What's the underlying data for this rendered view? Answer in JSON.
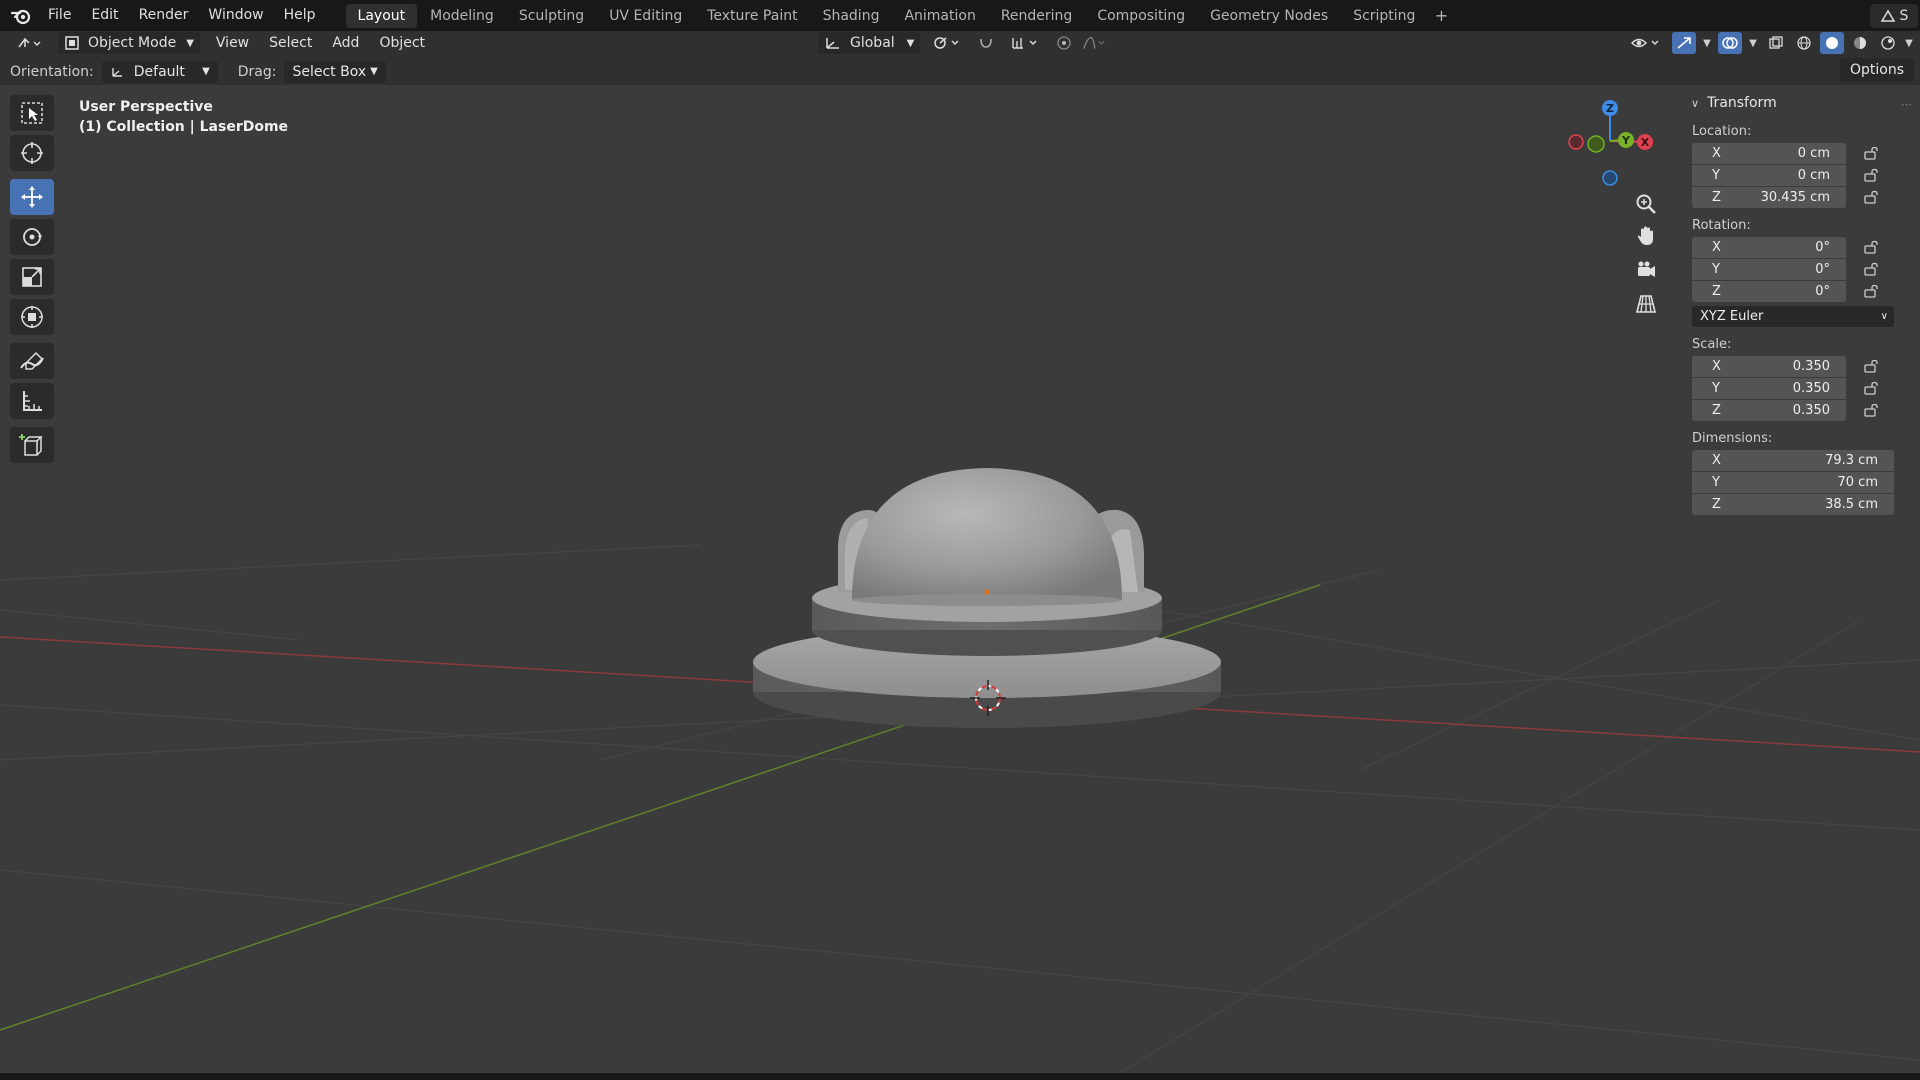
{
  "topbar": {
    "menu": [
      "File",
      "Edit",
      "Render",
      "Window",
      "Help"
    ],
    "workspaces": [
      "Layout",
      "Modeling",
      "Sculpting",
      "UV Editing",
      "Texture Paint",
      "Shading",
      "Animation",
      "Rendering",
      "Compositing",
      "Geometry Nodes",
      "Scripting"
    ],
    "active_workspace": "Layout",
    "add_workspace": "+",
    "scene_letter": "S"
  },
  "header": {
    "mode": "Object Mode",
    "menus": [
      "View",
      "Select",
      "Add",
      "Object"
    ],
    "transform_orientation": "Global"
  },
  "tool_settings": {
    "orientation_label": "Orientation:",
    "orientation_value": "Default",
    "drag_label": "Drag:",
    "drag_value": "Select Box",
    "options_label": "Options"
  },
  "viewport": {
    "perspective": "User Perspective",
    "collection": "(1) Collection | LaserDome"
  },
  "gizmo": {
    "z": "Z",
    "x": "X",
    "y": "Y",
    "colors": {
      "x": "#e0414f",
      "y": "#77b22a",
      "z": "#3f8ce6"
    }
  },
  "npanel": {
    "title": "Transform",
    "location": {
      "label": "Location:",
      "x": "0 cm",
      "y": "0 cm",
      "z": "30.435 cm"
    },
    "rotation": {
      "label": "Rotation:",
      "x": "0°",
      "y": "0°",
      "z": "0°"
    },
    "rotation_mode": "XYZ Euler",
    "scale": {
      "label": "Scale:",
      "x": "0.350",
      "y": "0.350",
      "z": "0.350"
    },
    "dimensions": {
      "label": "Dimensions:",
      "x": "79.3 cm",
      "y": "70 cm",
      "z": "38.5 cm"
    },
    "axis_letters": {
      "x": "X",
      "y": "Y",
      "z": "Z"
    }
  },
  "tools": [
    "select-box-tool",
    "cursor-tool",
    "move-tool",
    "rotate-tool",
    "scale-tool",
    "transform-tool",
    "annotate-tool",
    "measure-tool",
    "add-cube-tool"
  ],
  "colors": {
    "accent": "#4772b3",
    "x_axis_line": "#8a3a3e",
    "y_axis_line": "#5f7d2a"
  }
}
